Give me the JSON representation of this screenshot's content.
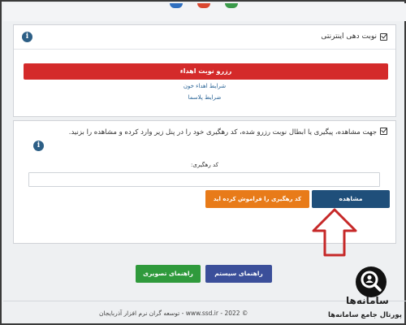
{
  "colors": {
    "reserve": "#d42a2a",
    "view": "#1f4f7a",
    "forgot": "#e87b19",
    "green": "#2f9a3c",
    "blue": "#3b4f9a",
    "link": "#2a6496"
  },
  "top_icons": [
    "#2f6fbf",
    "#d9472f",
    "#3a9a4a"
  ],
  "online_panel": {
    "title": "نوبت دهی اینترنتی",
    "reserve_button": "رزرو نوبت اهداء",
    "link_conditions": "شرایط اهداء خون",
    "link_rules": "ضرایط پلاسما"
  },
  "tracking_panel": {
    "description": "جهت مشاهده، پیگیری یا ابطال نوبت رزرو شده، کد رهگیری خود را در پنل زیر وارد کرده و مشاهده را بزنید.",
    "field_label": "کد رهگیری:",
    "field_value": "",
    "view_button": "مشاهده",
    "forgot_button": "کد رهگیری را فراموش کرده اید"
  },
  "guides": {
    "user_guide": "راهنمای تصویری",
    "system_guide": "راهنمای سیستم"
  },
  "footer": "© 2022 - www.ssd.ir - توسعه گران نرم افزار آذربایجان",
  "watermark": {
    "brand": "سامانه‌ها",
    "subtitle": "پورتال جامع سامانه‌ها",
    "icon": "search-person-icon"
  }
}
